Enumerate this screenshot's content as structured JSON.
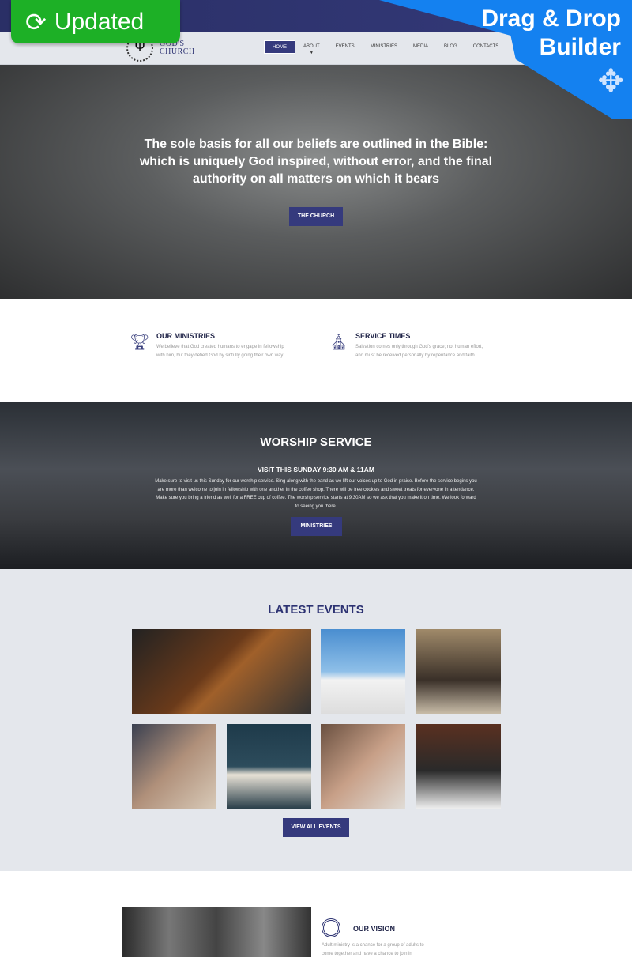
{
  "badges": {
    "updated": "Updated",
    "drag_drop_line1": "Drag & Drop",
    "drag_drop_line2": "Builder"
  },
  "logo": {
    "line1": "GOD'S",
    "line2": "CHURCH"
  },
  "nav": {
    "items": [
      {
        "label": "HOME",
        "active": true
      },
      {
        "label": "ABOUT"
      },
      {
        "label": "EVENTS"
      },
      {
        "label": "MINISTRIES"
      },
      {
        "label": "MEDIA"
      },
      {
        "label": "BLOG"
      },
      {
        "label": "CONTACTS"
      }
    ]
  },
  "hero": {
    "headline": "The sole basis for all our beliefs are outlined in the Bible: which is uniquely God inspired, without error, and the final authority on all matters on which it bears",
    "button": "THE CHURCH"
  },
  "features": [
    {
      "title": "OUR MINISTRIES",
      "icon": "chalice-icon",
      "text": "We believe that God created humans to engage in fellowship with him, but they defied God by sinfully going their own way."
    },
    {
      "title": "SERVICE TIMES",
      "icon": "church-icon",
      "text": "Salvation comes only through God's grace; not human effort, and must be received personally by repentance and faith."
    }
  ],
  "worship": {
    "title": "WORSHIP SERVICE",
    "subtitle": "VISIT THIS SUNDAY 9:30 AM & 11AM",
    "text": "Make sure to visit us this Sunday for our worship service. Sing along with the band as we lift our voices up to God in praise. Before the service begins you are more than welcome to join in fellowship with one another in the coffee shop. There will be free cookies and sweet treats for everyone in attendance. Make sure you bring a friend as well for a FREE cup of coffee. The worship service starts at 9:30AM so we ask that you make it on time. We look forward to seeing you there.",
    "button": "MINISTRIES"
  },
  "events": {
    "title": "LATEST EVENTS",
    "button": "VIEW ALL EVENTS"
  },
  "vision": {
    "title": "OUR VISION",
    "text": "Adult ministry is a chance for a group of adults to come together and have a chance to join in"
  },
  "colors": {
    "primary": "#353a7d",
    "updated_badge": "#1db026",
    "dnd_badge": "#1481f0",
    "events_bg": "#e4e7ec"
  }
}
